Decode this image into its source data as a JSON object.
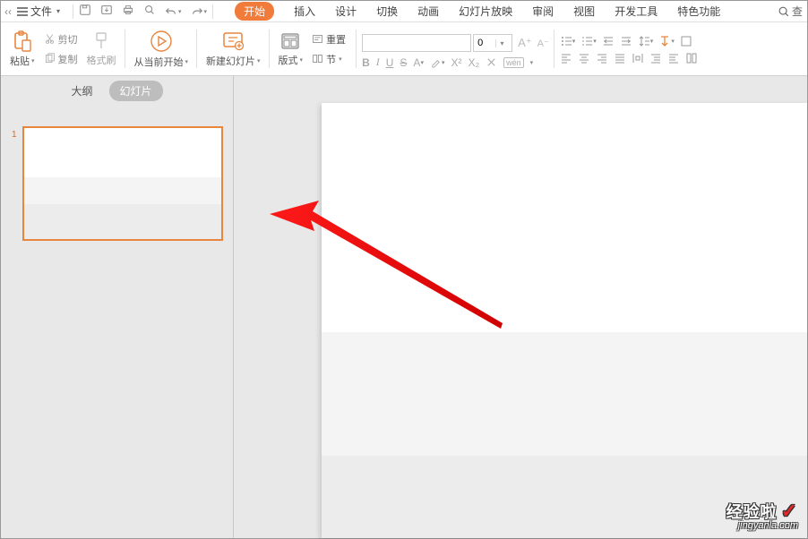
{
  "menu": {
    "file": "文件",
    "tabs": [
      "开始",
      "插入",
      "设计",
      "切换",
      "动画",
      "幻灯片放映",
      "审阅",
      "视图",
      "开发工具",
      "特色功能"
    ],
    "search": "查"
  },
  "ribbon": {
    "paste": "粘贴",
    "cut": "剪切",
    "copy": "复制",
    "format_painter": "格式刷",
    "from_current": "从当前开始",
    "new_slide": "新建幻灯片",
    "layout": "版式",
    "reset": "重置",
    "section": "节",
    "font_name": "",
    "font_size": "0",
    "wen": "wén"
  },
  "sidebar": {
    "outline": "大纲",
    "slides": "幻灯片",
    "slide_index": "1"
  },
  "watermark": {
    "line1": "经验啦",
    "line2": "jingyanla.com"
  }
}
